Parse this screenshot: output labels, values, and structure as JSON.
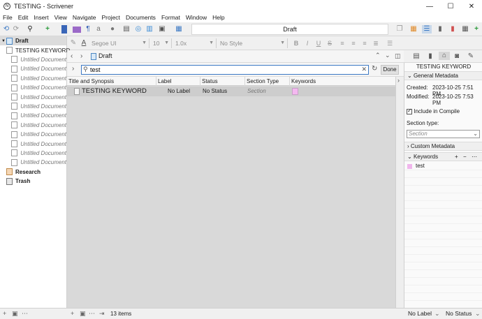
{
  "window": {
    "title": "TESTING - Scrivener",
    "app_glyph": "N",
    "minimize": "—",
    "maximize": "☐",
    "close": "✕"
  },
  "menu": [
    "File",
    "Edit",
    "Insert",
    "View",
    "Navigate",
    "Project",
    "Documents",
    "Format",
    "Window",
    "Help"
  ],
  "toolbar": {
    "document_title": "Draft"
  },
  "format": {
    "font": "Segoe UI",
    "size": "10",
    "spacing": "1.0x",
    "style": "No Style",
    "bold": "B",
    "italic": "I",
    "underline": "U",
    "strike": "S"
  },
  "binder": {
    "items": [
      {
        "label": "Draft",
        "kind": "draft",
        "bold": true,
        "italic": false,
        "selected": true,
        "triangle": "▼",
        "indent": 0
      },
      {
        "label": "TESTING KEYWORD",
        "kind": "doc",
        "bold": false,
        "italic": false,
        "selected": false,
        "triangle": "",
        "indent": 1
      },
      {
        "label": "Untitled Document",
        "kind": "doc",
        "bold": false,
        "italic": true,
        "selected": false,
        "triangle": "",
        "indent": 1
      },
      {
        "label": "Untitled Document",
        "kind": "doc",
        "bold": false,
        "italic": true,
        "selected": false,
        "triangle": "",
        "indent": 1
      },
      {
        "label": "Untitled Document",
        "kind": "doc",
        "bold": false,
        "italic": true,
        "selected": false,
        "triangle": "",
        "indent": 1
      },
      {
        "label": "Untitled Document",
        "kind": "doc",
        "bold": false,
        "italic": true,
        "selected": false,
        "triangle": "",
        "indent": 1
      },
      {
        "label": "Untitled Document",
        "kind": "doc",
        "bold": false,
        "italic": true,
        "selected": false,
        "triangle": "",
        "indent": 1
      },
      {
        "label": "Untitled Document",
        "kind": "doc",
        "bold": false,
        "italic": true,
        "selected": false,
        "triangle": "",
        "indent": 1
      },
      {
        "label": "Untitled Document",
        "kind": "doc",
        "bold": false,
        "italic": true,
        "selected": false,
        "triangle": "",
        "indent": 1
      },
      {
        "label": "Untitled Document",
        "kind": "doc",
        "bold": false,
        "italic": true,
        "selected": false,
        "triangle": "",
        "indent": 1
      },
      {
        "label": "Untitled Document",
        "kind": "doc",
        "bold": false,
        "italic": true,
        "selected": false,
        "triangle": "",
        "indent": 1
      },
      {
        "label": "Untitled Document",
        "kind": "doc",
        "bold": false,
        "italic": true,
        "selected": false,
        "triangle": "",
        "indent": 1
      },
      {
        "label": "Untitled Document",
        "kind": "doc",
        "bold": false,
        "italic": true,
        "selected": false,
        "triangle": "",
        "indent": 1
      },
      {
        "label": "Untitled Document",
        "kind": "doc",
        "bold": false,
        "italic": true,
        "selected": false,
        "triangle": "",
        "indent": 1
      },
      {
        "label": "Research",
        "kind": "research",
        "bold": true,
        "italic": false,
        "selected": false,
        "triangle": "",
        "indent": 0
      },
      {
        "label": "Trash",
        "kind": "trash",
        "bold": true,
        "italic": false,
        "selected": false,
        "triangle": "",
        "indent": 0
      }
    ]
  },
  "editor": {
    "header_title": "Draft"
  },
  "search": {
    "value": "test",
    "done_label": "Done"
  },
  "outline": {
    "columns": [
      "Title and Synopsis",
      "Label",
      "Status",
      "Section Type",
      "Keywords"
    ],
    "rows": [
      {
        "title": "TESTING KEYWORD",
        "label": "No Label",
        "status": "No Status",
        "section_type": "Section",
        "keyword_color": "#f4b8f0"
      }
    ],
    "item_count": "13 items"
  },
  "inspector": {
    "doc_title": "TESTING KEYWORD",
    "general_metadata": "General Metadata",
    "created_label": "Created:",
    "created_value": "2023-10-25 7:51 PM",
    "modified_label": "Modified:",
    "modified_value": "2023-10-25 7:53 PM",
    "include_compile": "Include in Compile",
    "section_type_label": "Section type:",
    "section_type_value": "Section",
    "custom_metadata": "Custom Metadata",
    "keywords_header": "Keywords",
    "keywords": [
      {
        "name": "test",
        "color": "#f0b6ec"
      }
    ]
  },
  "footer": {
    "label": "No Label",
    "status": "No Status"
  },
  "colors": {
    "selection": "#cdcdcd",
    "accent": "#3b78c4"
  }
}
